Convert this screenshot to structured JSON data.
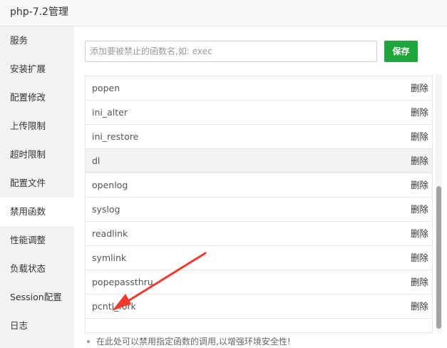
{
  "window": {
    "title": "php-7.2管理"
  },
  "sidebar": {
    "items": [
      {
        "label": "服务"
      },
      {
        "label": "安装扩展"
      },
      {
        "label": "配置修改"
      },
      {
        "label": "上传限制"
      },
      {
        "label": "超时限制"
      },
      {
        "label": "配置文件"
      },
      {
        "label": "禁用函数",
        "active": true
      },
      {
        "label": "性能调整"
      },
      {
        "label": "负载状态"
      },
      {
        "label": "Session配置"
      },
      {
        "label": "日志"
      }
    ]
  },
  "main": {
    "input_placeholder": "添加要被禁止的函数名,如: exec",
    "save_label": "保存",
    "functions": [
      {
        "name": "popen",
        "action": "删除"
      },
      {
        "name": "ini_alter",
        "action": "删除"
      },
      {
        "name": "ini_restore",
        "action": "删除"
      },
      {
        "name": "dl",
        "action": "删除"
      },
      {
        "name": "openlog",
        "action": "删除"
      },
      {
        "name": "syslog",
        "action": "删除"
      },
      {
        "name": "readlink",
        "action": "删除"
      },
      {
        "name": "symlink",
        "action": "删除"
      },
      {
        "name": "popepassthru",
        "action": "删除"
      },
      {
        "name": "pcntl_fork",
        "action": "删除"
      }
    ],
    "tip": "在此处可以禁用指定函数的调用,以增强环境安全性!"
  },
  "colors": {
    "accent_green": "#20a53a",
    "annotation_arrow": "#f03a2e",
    "sidebar_bg": "#f2f2f2"
  }
}
